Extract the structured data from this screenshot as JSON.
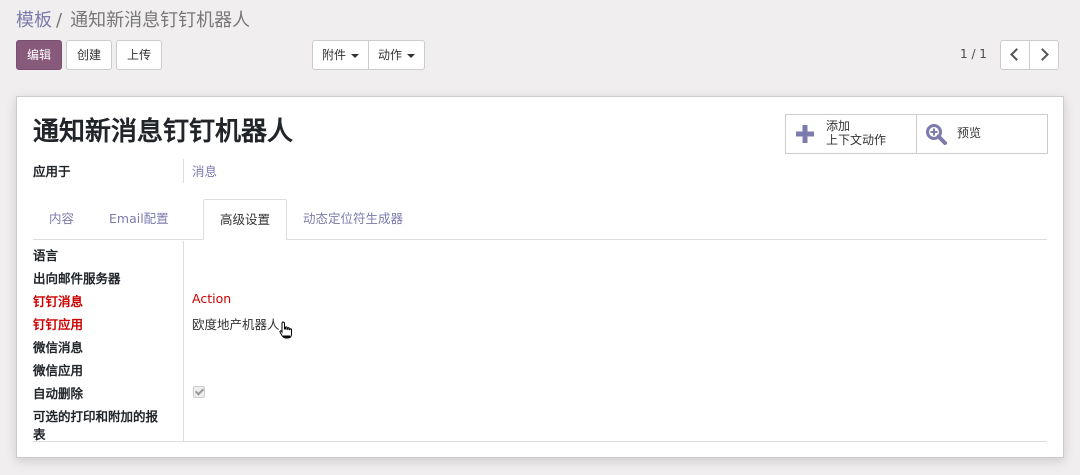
{
  "breadcrumb": {
    "parent": "模板",
    "separator": "/",
    "current": "通知新消息钉钉机器人"
  },
  "toolbar": {
    "edit_label": "编辑",
    "create_label": "创建",
    "upload_label": "上传",
    "attachment_label": "附件",
    "action_label": "动作"
  },
  "pager": {
    "value": "1 / 1"
  },
  "record": {
    "title": "通知新消息钉钉机器人",
    "button_box": {
      "add_context_action_line1": "添加",
      "add_context_action_line2": "上下文动作",
      "preview_label": "预览"
    },
    "applies_to": {
      "label": "应用于",
      "value": "消息"
    }
  },
  "tabs": [
    {
      "label": "内容"
    },
    {
      "label": "Email配置"
    },
    {
      "label": "高级设置"
    },
    {
      "label": "动态定位符生成器"
    }
  ],
  "active_tab": "高级设置",
  "advanced": {
    "fields": [
      {
        "label": "语言",
        "value": ""
      },
      {
        "label": "出向邮件服务器",
        "value": ""
      },
      {
        "label": "钉钉消息",
        "value": "Action"
      },
      {
        "label": "钉钉应用",
        "value": "欧度地产机器人"
      },
      {
        "label": "微信消息",
        "value": ""
      },
      {
        "label": "微信应用",
        "value": ""
      },
      {
        "label": "自动删除",
        "value": ""
      },
      {
        "label_line1": "可选的打印和附加的报",
        "label_line2": "表",
        "value": ""
      }
    ],
    "auto_delete_checked": true
  },
  "colors": {
    "brand": "#875a7b",
    "link": "#7c7bad",
    "required": "#cc0000",
    "background": "#f0eeee"
  },
  "icons": {
    "add_context_action": "plus-icon",
    "preview": "search-plus-icon",
    "pager_previous": "chevron-left-icon",
    "pager_next": "chevron-right-icon",
    "dropdown": "caret-down-icon"
  }
}
